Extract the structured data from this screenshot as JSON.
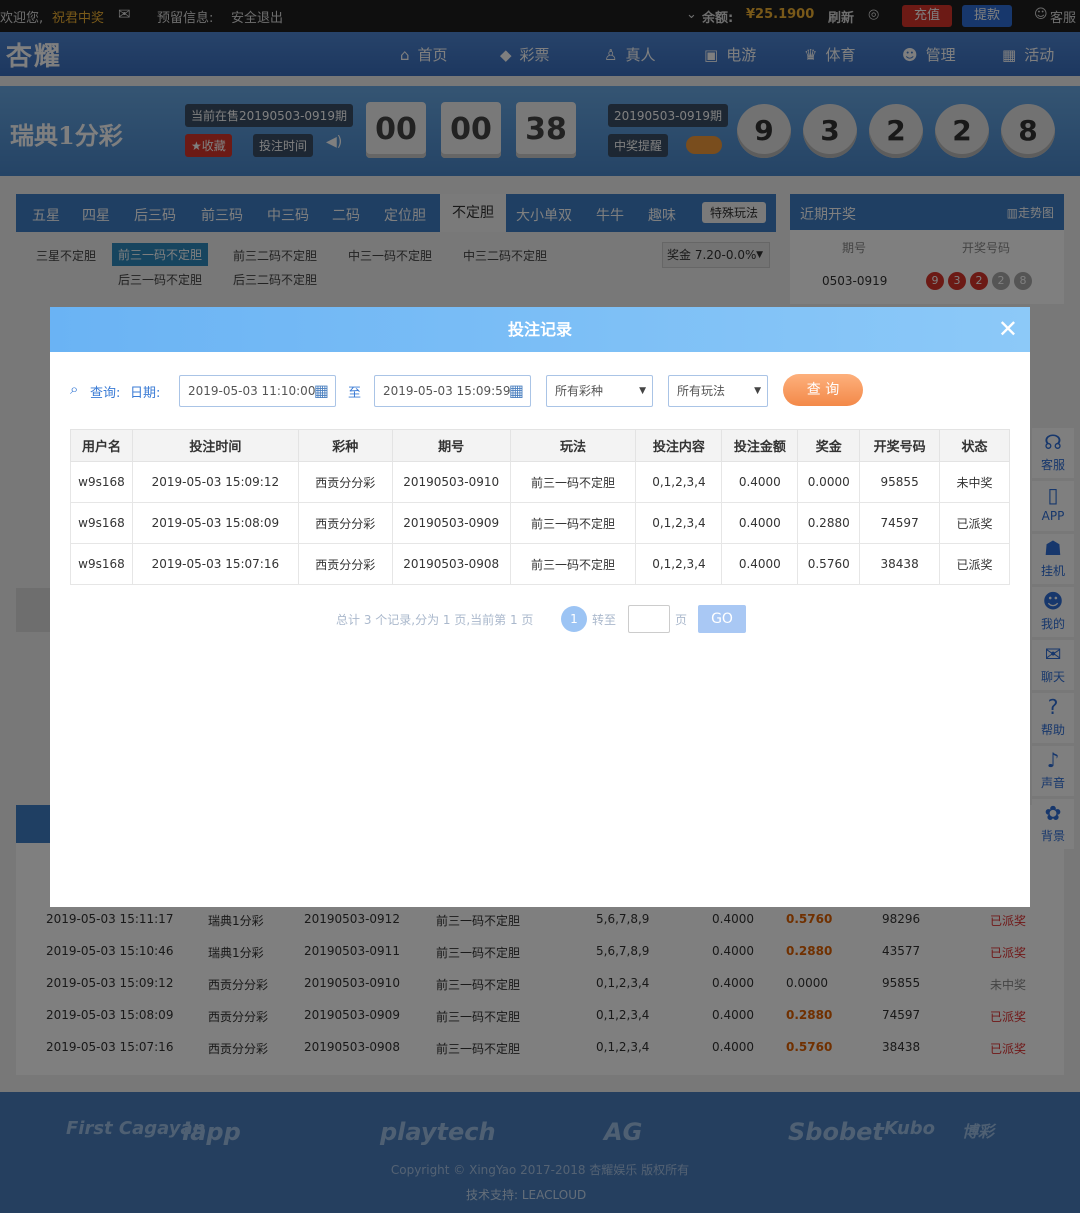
{
  "topbar": {
    "welcome": "欢迎您,",
    "username": "祝君中奖",
    "reserved_info": "预留信息:",
    "logout": "安全退出",
    "balance_label": "余额:",
    "balance_value": "¥25.1900",
    "refresh": "刷新",
    "recharge": "充值",
    "withdraw": "提款",
    "service": "客服"
  },
  "nav": {
    "logo": "杏耀",
    "items": [
      {
        "label": "首页",
        "icon": "home-icon"
      },
      {
        "label": "彩票",
        "icon": "ticket-icon"
      },
      {
        "label": "真人",
        "icon": "person-icon"
      },
      {
        "label": "电游",
        "icon": "game-icon"
      },
      {
        "label": "体育",
        "icon": "trophy-icon"
      },
      {
        "label": "管理",
        "icon": "users-icon"
      },
      {
        "label": "活动",
        "icon": "gift-icon"
      }
    ]
  },
  "lottery": {
    "name": "瑞典1分彩",
    "on_sale": "当前在售20190503-0919期",
    "favorite": "收藏",
    "bet_time": "投注时间",
    "countdown": [
      "00",
      "00",
      "38"
    ],
    "last_issue": "20190503-0919期",
    "win_notice": "中奖提醒",
    "balls": [
      "9",
      "3",
      "2",
      "2",
      "8"
    ]
  },
  "play_tabs": {
    "tabs": [
      "五星",
      "四星",
      "后三码",
      "前三码",
      "中三码",
      "二码",
      "定位胆",
      "不定胆",
      "大小单双",
      "牛牛",
      "趣味"
    ],
    "active": "不定胆",
    "special": "特殊玩法",
    "sub_row1": [
      "三星不定胆",
      "前三一码不定胆",
      "前三二码不定胆",
      "中三一码不定胆",
      "中三二码不定胆"
    ],
    "sub_row2": [
      "后三一码不定胆",
      "后三二码不定胆"
    ],
    "prize": "奖金 7.20-0.0%"
  },
  "recent": {
    "title": "近期开奖",
    "trend": "走势图",
    "col_issue": "期号",
    "col_numbers": "开奖号码",
    "issue": "0503-0919",
    "numbers": [
      "9",
      "3",
      "2",
      "2",
      "8"
    ]
  },
  "sidebar": [
    {
      "label": "客服",
      "icon": "headset-icon"
    },
    {
      "label": "APP",
      "icon": "phone-icon"
    },
    {
      "label": "挂机",
      "icon": "robot-icon"
    },
    {
      "label": "我的",
      "icon": "user-icon"
    },
    {
      "label": "聊天",
      "icon": "chat-icon"
    },
    {
      "label": "帮助",
      "icon": "help-icon"
    },
    {
      "label": "声音",
      "icon": "sound-icon"
    },
    {
      "label": "背景",
      "icon": "palette-icon"
    }
  ],
  "bg_records": [
    {
      "time": "2019-05-03 15:11:17",
      "lottery": "瑞典1分彩",
      "issue": "20190503-0912",
      "play": "前三一码不定胆",
      "content": "5,6,7,8,9",
      "amount": "0.4000",
      "prize": "0.5760",
      "draw": "98296",
      "status": "已派奖"
    },
    {
      "time": "2019-05-03 15:10:46",
      "lottery": "瑞典1分彩",
      "issue": "20190503-0911",
      "play": "前三一码不定胆",
      "content": "5,6,7,8,9",
      "amount": "0.4000",
      "prize": "0.2880",
      "draw": "43577",
      "status": "已派奖"
    },
    {
      "time": "2019-05-03 15:09:12",
      "lottery": "西贡分分彩",
      "issue": "20190503-0910",
      "play": "前三一码不定胆",
      "content": "0,1,2,3,4",
      "amount": "0.4000",
      "prize": "0.0000",
      "draw": "95855",
      "status": "未中奖"
    },
    {
      "time": "2019-05-03 15:08:09",
      "lottery": "西贡分分彩",
      "issue": "20190503-0909",
      "play": "前三一码不定胆",
      "content": "0,1,2,3,4",
      "amount": "0.4000",
      "prize": "0.2880",
      "draw": "74597",
      "status": "已派奖"
    },
    {
      "time": "2019-05-03 15:07:16",
      "lottery": "西贡分分彩",
      "issue": "20190503-0908",
      "play": "前三一码不定胆",
      "content": "0,1,2,3,4",
      "amount": "0.4000",
      "prize": "0.5760",
      "draw": "38438",
      "status": "已派奖"
    }
  ],
  "footer": {
    "logos": [
      "First Cagayan",
      "iapp",
      "playtech",
      "AG",
      "Sbobet",
      "Kubo",
      "博彩"
    ],
    "copyright": "Copyright © XingYao 2017-2018 杏耀娱乐 版权所有",
    "support": "技术支持:",
    "support_brand": "LEACLOUD"
  },
  "modal": {
    "title": "投注记录",
    "query_label": "查询:",
    "date_label": "日期:",
    "date_from": "2019-05-03 11:10:00",
    "to": "至",
    "date_to": "2019-05-03 15:09:59",
    "lottery_select": "所有彩种",
    "play_select": "所有玩法",
    "query_button": "查 询",
    "columns": [
      "用户名",
      "投注时间",
      "彩种",
      "期号",
      "玩法",
      "投注内容",
      "投注金额",
      "奖金",
      "开奖号码",
      "状态"
    ],
    "rows": [
      {
        "user": "w9s168",
        "time": "2019-05-03 15:09:12",
        "lottery": "西贡分分彩",
        "issue": "20190503-0910",
        "play": "前三一码不定胆",
        "content": "0,1,2,3,4",
        "amount": "0.4000",
        "prize": "0.0000",
        "draw": "95855",
        "status": "未中奖"
      },
      {
        "user": "w9s168",
        "time": "2019-05-03 15:08:09",
        "lottery": "西贡分分彩",
        "issue": "20190503-0909",
        "play": "前三一码不定胆",
        "content": "0,1,2,3,4",
        "amount": "0.4000",
        "prize": "0.2880",
        "draw": "74597",
        "status": "已派奖"
      },
      {
        "user": "w9s168",
        "time": "2019-05-03 15:07:16",
        "lottery": "西贡分分彩",
        "issue": "20190503-0908",
        "play": "前三一码不定胆",
        "content": "0,1,2,3,4",
        "amount": "0.4000",
        "prize": "0.5760",
        "draw": "38438",
        "status": "已派奖"
      }
    ],
    "pager": {
      "summary": "总计 3 个记录,分为 1 页,当前第 1 页",
      "current": "1",
      "goto": "转至",
      "page_unit": "页",
      "go": "GO"
    }
  },
  "colors": {
    "accent_blue": "#3f7fc7",
    "recharge_red": "#d9342b",
    "paid_orange": "#e07b00",
    "query_orange": "#f38949"
  }
}
